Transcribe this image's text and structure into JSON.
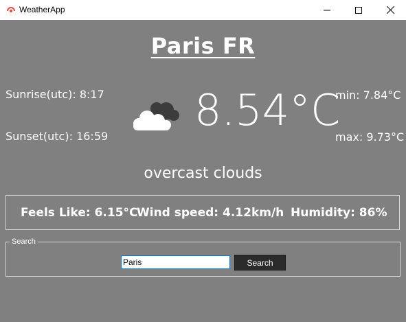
{
  "window": {
    "title": "WeatherApp"
  },
  "weather": {
    "city": "Paris FR",
    "sunrise": "Sunrise(utc): 8:17",
    "sunset": "Sunset(utc): 16:59",
    "temp_min": "min: 7.84°C",
    "temp_max": "max: 9.73°C",
    "temperature": "8.54°C",
    "description": "overcast clouds",
    "icon": "overcast-clouds-icon"
  },
  "details": {
    "feels_like": "Feels Like: 6.15°C",
    "wind_speed": "Wind speed: 4.12km/h",
    "humidity": "Humidity: 86%"
  },
  "search": {
    "legend": "Search",
    "value": "Paris",
    "button_label": "Search"
  },
  "colors": {
    "background": "#808080",
    "text": "#ffffff",
    "button": "#2b2b2b"
  }
}
